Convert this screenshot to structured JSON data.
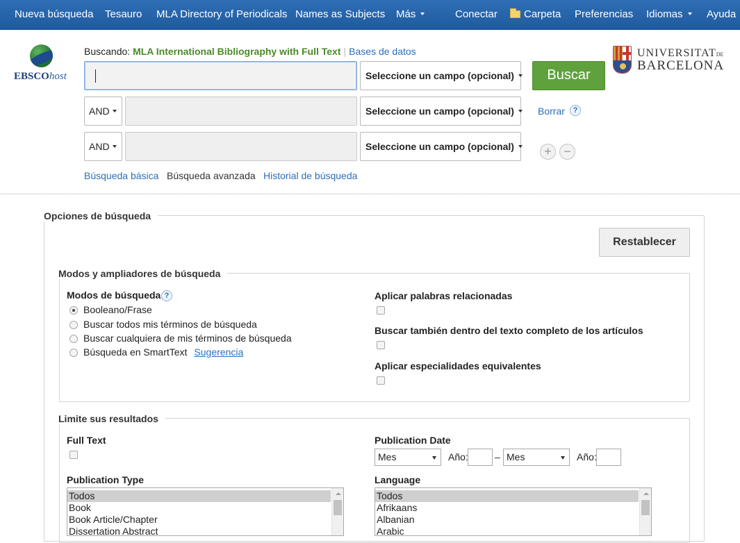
{
  "nav": {
    "new_search": "Nueva búsqueda",
    "thesaurus": "Tesauro",
    "mla_directory": "MLA Directory of Periodicals",
    "names_subjects": "Names as Subjects",
    "more": "Más",
    "sign_in": "Conectar",
    "folder": "Carpeta",
    "preferences": "Preferencias",
    "languages": "Idiomas",
    "help": "Ayuda"
  },
  "logo": {
    "brand": "EBSCO",
    "brand_suffix": "host"
  },
  "search": {
    "searching_label": "Buscando:",
    "database": "MLA International Bibliography with Full Text",
    "databases_link": "Bases de datos",
    "field_select": "Seleccione un campo (opcional)",
    "operator": "AND",
    "search_button": "Buscar",
    "clear_link": "Borrar",
    "add_row": "+",
    "remove_row": "−",
    "help": "?"
  },
  "institution": {
    "line1": "UNIVERSITAT",
    "line1_small": "DE",
    "line2": "BARCELONA"
  },
  "modes_nav": {
    "basic": "Búsqueda básica",
    "advanced": "Búsqueda avanzada",
    "history": "Historial de búsqueda"
  },
  "options": {
    "title": "Opciones de búsqueda",
    "reset_button": "Restablecer",
    "modes_section": {
      "title": "Modos y ampliadores de búsqueda",
      "modes_label": "Modos de búsqueda",
      "help": "?",
      "radios": [
        "Booleano/Frase",
        "Buscar todos mis términos de búsqueda",
        "Buscar cualquiera de mis términos de búsqueda",
        "Búsqueda en SmartText"
      ],
      "hint_link": "Sugerencia",
      "related_words": "Aplicar palabras relacionadas",
      "fulltext_search": "Buscar también dentro del texto completo de los artículos",
      "equivalent_subjects": "Aplicar especialidades equivalentes"
    },
    "limits_section": {
      "title": "Limite sus resultados",
      "full_text": "Full Text",
      "publication_date": "Publication Date",
      "month": "Mes",
      "year": "Año:",
      "dash": "–",
      "publication_type": "Publication Type",
      "publication_types": [
        "Todos",
        "Book",
        "Book Article/Chapter",
        "Dissertation Abstract"
      ],
      "language": "Language",
      "languages": [
        "Todos",
        "Afrikaans",
        "Albanian",
        "Arabic"
      ]
    }
  }
}
